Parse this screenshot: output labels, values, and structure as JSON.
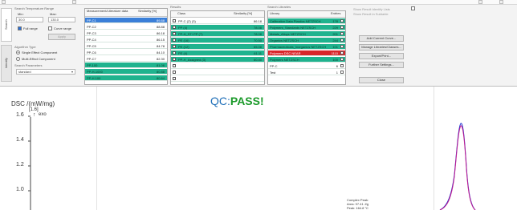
{
  "top_bar": {
    "title": ""
  },
  "side_tabs": {
    "tab_top": "Search",
    "tab_bottom": "Identify"
  },
  "search_params": {
    "group_title": "Search Temperature Range",
    "min_label": "Min:",
    "max_label": "Max:",
    "min_value": "30.0",
    "max_value": "130.0",
    "full_range_label": "Full range",
    "curve_range_label": "Curve range",
    "apply_label": "Apply",
    "algorithm_title": "Algorithm Type",
    "algo_single": "Single Effect Component",
    "algo_multi": "Multi-Effect Component",
    "parameters_title": "Search Parameters",
    "parameters_value": "standard"
  },
  "measurement_table": {
    "headers": [
      "Measurement/Literature data",
      "Similarity [%]"
    ],
    "rows": [
      {
        "name": "PP-C1",
        "similarity": "89.88",
        "style": "sel"
      },
      {
        "name": "PP-C2",
        "similarity": "88.88",
        "style": "w"
      },
      {
        "name": "PP-C3",
        "similarity": "86.18",
        "style": "w"
      },
      {
        "name": "PP-C4",
        "similarity": "86.15",
        "style": "w"
      },
      {
        "name": "PP-C5",
        "similarity": "84.78",
        "style": "w"
      },
      {
        "name": "PP-C6",
        "similarity": "84.10",
        "style": "w"
      },
      {
        "name": "PP-C7",
        "similarity": "82.30",
        "style": "w"
      },
      {
        "name": "PP-100",
        "similarity": "81.06",
        "style": "g"
      },
      {
        "name": "PP-H-1000",
        "similarity": "80.88",
        "style": "g"
      },
      {
        "name": "PP-H 100",
        "similarity": "80.64",
        "style": "g"
      }
    ]
  },
  "results": {
    "group_title": "Results",
    "headers": [
      "Class",
      "Similarity [%]"
    ],
    "rows": [
      {
        "name": "PP-C (Z) (3)",
        "similarity": "86.18",
        "style": "w"
      },
      {
        "name": "PP (4)",
        "similarity": "78.08",
        "style": "g"
      },
      {
        "name": "PP-H_ST/ PP (T)",
        "similarity": "78.08",
        "style": "g"
      },
      {
        "name": "PE (16)",
        "similarity": "70.50",
        "style": "g"
      },
      {
        "name": "PE (12)",
        "similarity": "65.08",
        "style": "g"
      },
      {
        "name": "PE (4)",
        "similarity": "61.11",
        "style": "g"
      },
      {
        "name": "PP-H_Assigned (3)",
        "similarity": "60.40",
        "style": "g"
      },
      {
        "name": "",
        "similarity": "",
        "style": "w"
      },
      {
        "name": "",
        "similarity": "",
        "style": "w"
      },
      {
        "name": "",
        "similarity": "",
        "style": "w"
      }
    ]
  },
  "libraries": {
    "group_title": "Search Libraries",
    "headers": [
      "Library",
      "Entries"
    ],
    "rows": [
      {
        "name": "Calibration Data Plastics NETZSCH",
        "entries": "178",
        "style": "g"
      },
      {
        "name": "Polymers_Standards NETZSCH",
        "entries": "229",
        "style": "g"
      },
      {
        "name": "Metals_Alloys NETZSCH",
        "entries": "201",
        "style": "g"
      },
      {
        "name": "Organics NETZSCH",
        "entries": "244",
        "style": "g"
      },
      {
        "name": "Pharmaceuticals_Inorganics NETZSCH",
        "entries": "101",
        "style": "g"
      },
      {
        "name": "Polymers DSC NEAR",
        "entries": "1110",
        "style": "red"
      },
      {
        "name": "Polymers NETZSCH",
        "entries": "100",
        "style": "g"
      },
      {
        "name": "PP-C",
        "entries": "6",
        "style": "w"
      },
      {
        "name": "Test",
        "entries": "1",
        "style": "w"
      }
    ]
  },
  "right_panel": {
    "note": "Show Result Identify Lists",
    "note2": "Show Result in Subtable",
    "btn_add": "Add Current Curve...",
    "btn_manage": "Manage Libraries/Classes...",
    "btn_export": "Export/Print...",
    "btn_further": "Further Settings...",
    "btn_close": "Close"
  },
  "plot": {
    "status_prefix": "QC:",
    "status": "PASS!",
    "status_prefix_color": "#1f6fb8",
    "status_color": "#1b9a2a",
    "ylabel": "DSC /(mW/mg)",
    "ylabel_bracket": "[1.6]",
    "exo_label": "exo",
    "y_ticks": [
      "1.6",
      "1.4",
      "1.2",
      "1.0"
    ],
    "annotation_title": "Complex Peak:",
    "annotation_area": "Area: 97.41 J/g",
    "annotation_peak": "Peak: 164.8 °C"
  }
}
